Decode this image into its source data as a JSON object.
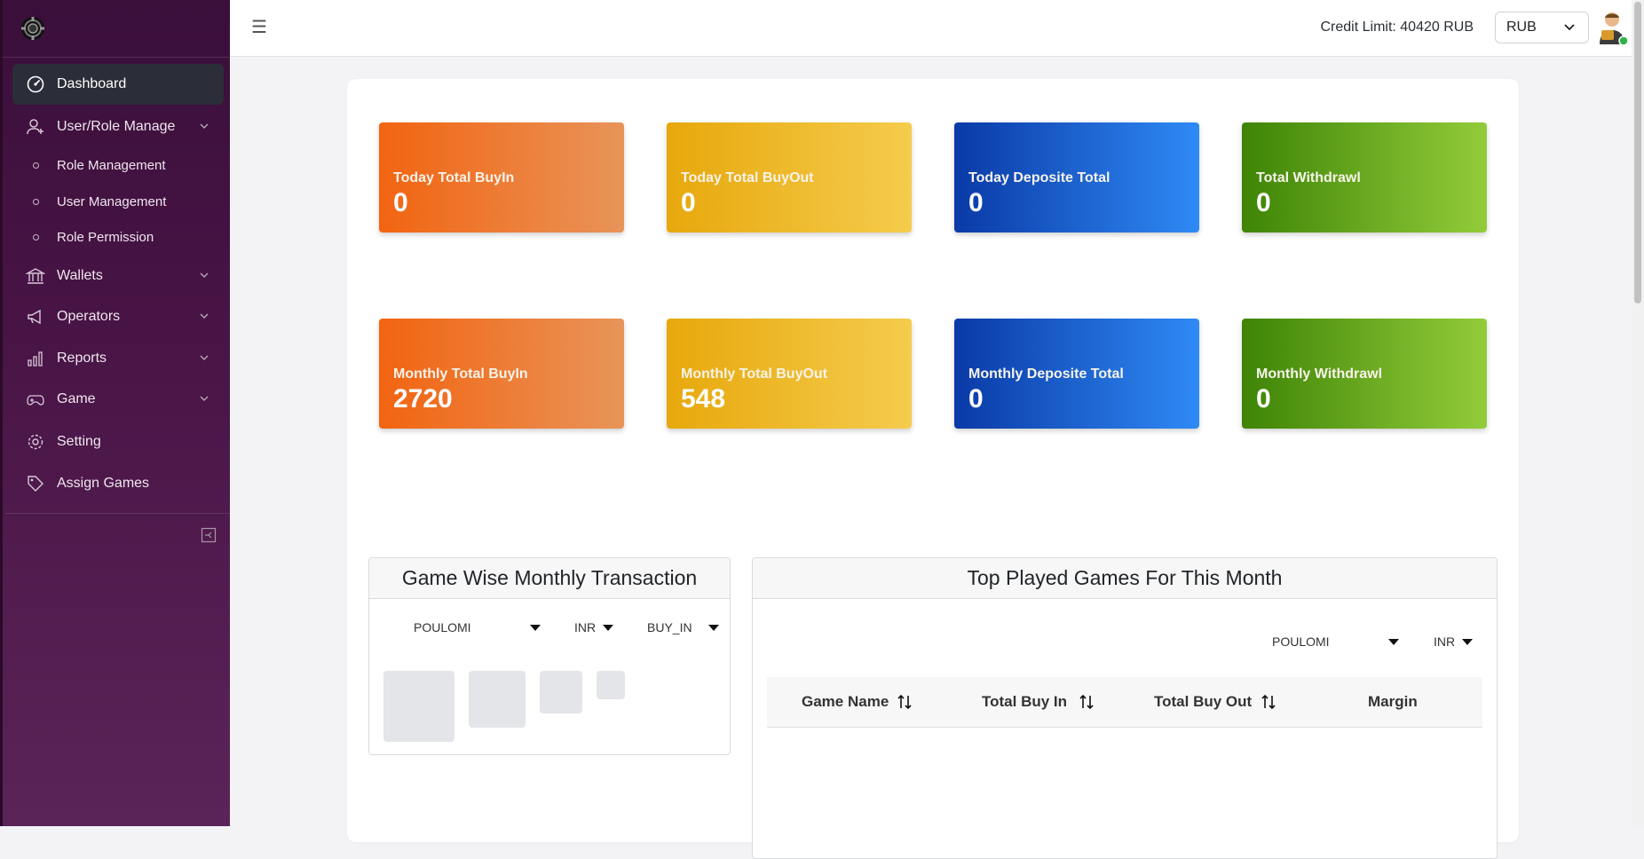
{
  "sidebar": {
    "items": [
      {
        "label": "Dashboard",
        "icon": "dashboard-gauge-icon",
        "active": true
      },
      {
        "label": "User/Role Manage",
        "icon": "user-add-icon",
        "expandable": true
      },
      {
        "label": "Wallets",
        "icon": "bank-icon",
        "expandable": true
      },
      {
        "label": "Operators",
        "icon": "megaphone-icon",
        "expandable": true
      },
      {
        "label": "Reports",
        "icon": "bar-chart-icon",
        "expandable": true
      },
      {
        "label": "Game",
        "icon": "gamepad-icon",
        "expandable": true
      },
      {
        "label": "Setting",
        "icon": "gear-icon"
      },
      {
        "label": "Assign Games",
        "icon": "tag-icon"
      }
    ],
    "subitems": [
      {
        "label": "Role Management"
      },
      {
        "label": "User Management"
      },
      {
        "label": "Role Permission"
      }
    ]
  },
  "topbar": {
    "credit_limit": "Credit Limit: 40420 RUB",
    "currency": "RUB"
  },
  "cards_today": [
    {
      "label": "Today Total BuyIn",
      "value": "0",
      "color": "#f26411"
    },
    {
      "label": "Today Total BuyOut",
      "value": "0",
      "color": "#e7a80c"
    },
    {
      "label": "Today Deposite Total",
      "value": "0",
      "color": "#0a3aa7"
    },
    {
      "label": "Total Withdrawl",
      "value": "0",
      "color": "#3e8406"
    }
  ],
  "cards_monthly": [
    {
      "label": "Monthly Total BuyIn",
      "value": "2720",
      "color": "#f26411"
    },
    {
      "label": "Monthly Total BuyOut",
      "value": "548",
      "color": "#e7a80c"
    },
    {
      "label": "Monthly Deposite Total",
      "value": "0",
      "color": "#0a3aa7"
    },
    {
      "label": "Monthly Withdrawl",
      "value": "0",
      "color": "#3e8406"
    }
  ],
  "game_wise": {
    "title": "Game Wise Monthly Transaction",
    "operator": "POULOMI",
    "currency": "INR",
    "type": "BUY_IN"
  },
  "top_played": {
    "title": "Top Played Games For This Month",
    "operator": "POULOMI",
    "currency": "INR",
    "columns": [
      "Game Name",
      "Total Buy In",
      "Total Buy Out",
      "Margin"
    ]
  }
}
